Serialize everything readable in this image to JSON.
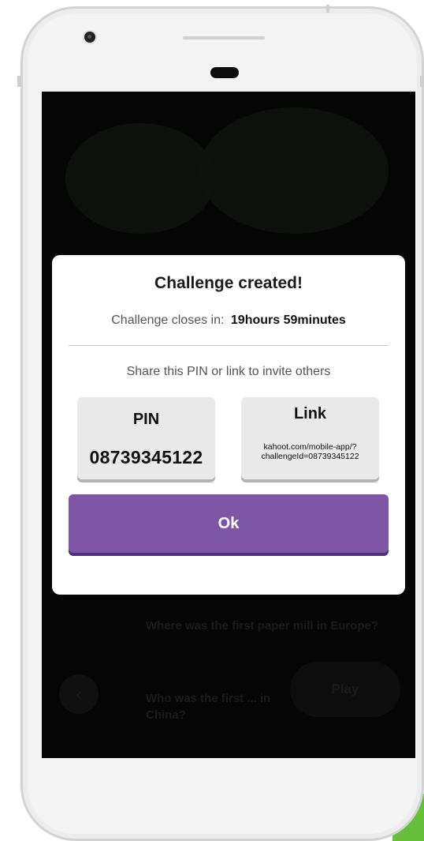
{
  "modal": {
    "title": "Challenge created!",
    "closes_label": "Challenge closes in:",
    "closes_value": "19hours 59minutes",
    "share_text": "Share this PIN or link to invite others",
    "pin_label": "PIN",
    "pin_value": "08739345122",
    "link_label": "Link",
    "link_value": "kahoot.com/mobile-app/?challengeId=08739345122",
    "ok_label": "Ok"
  },
  "background": {
    "question_1": "Where was the first paper mill in Europe?",
    "question_2": "Who was the first ... in China?",
    "play_label": "Play",
    "back_icon": "chevron-left-icon"
  },
  "colors": {
    "ok_button": "#7f56a6",
    "accent_green": "#66bf3c"
  }
}
